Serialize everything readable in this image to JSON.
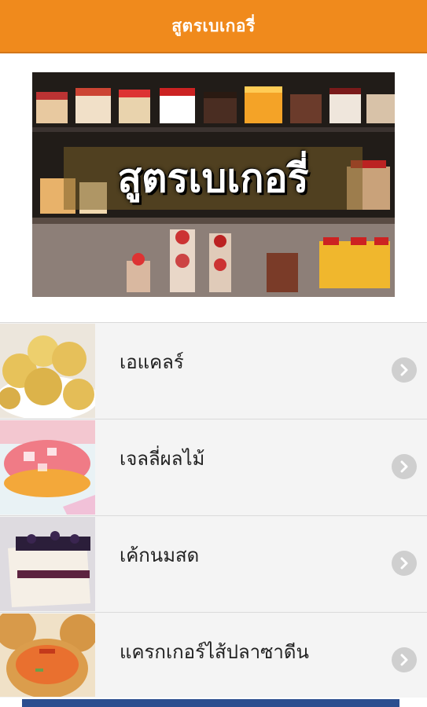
{
  "app": {
    "title": "สูตรเบเกอรี่"
  },
  "hero": {
    "caption": "สูตรเบเกอรี่",
    "accent_color": "#f08a1c"
  },
  "menu": {
    "items": [
      {
        "label": "เอแคลร์",
        "icon": "chevron-right-icon"
      },
      {
        "label": "เจลลี่ผลไม้",
        "icon": "chevron-right-icon"
      },
      {
        "label": "เค้กนมสด",
        "icon": "chevron-right-icon"
      },
      {
        "label": "แครกเกอร์ไส้ปลาซาดีน",
        "icon": "chevron-right-icon"
      }
    ]
  }
}
